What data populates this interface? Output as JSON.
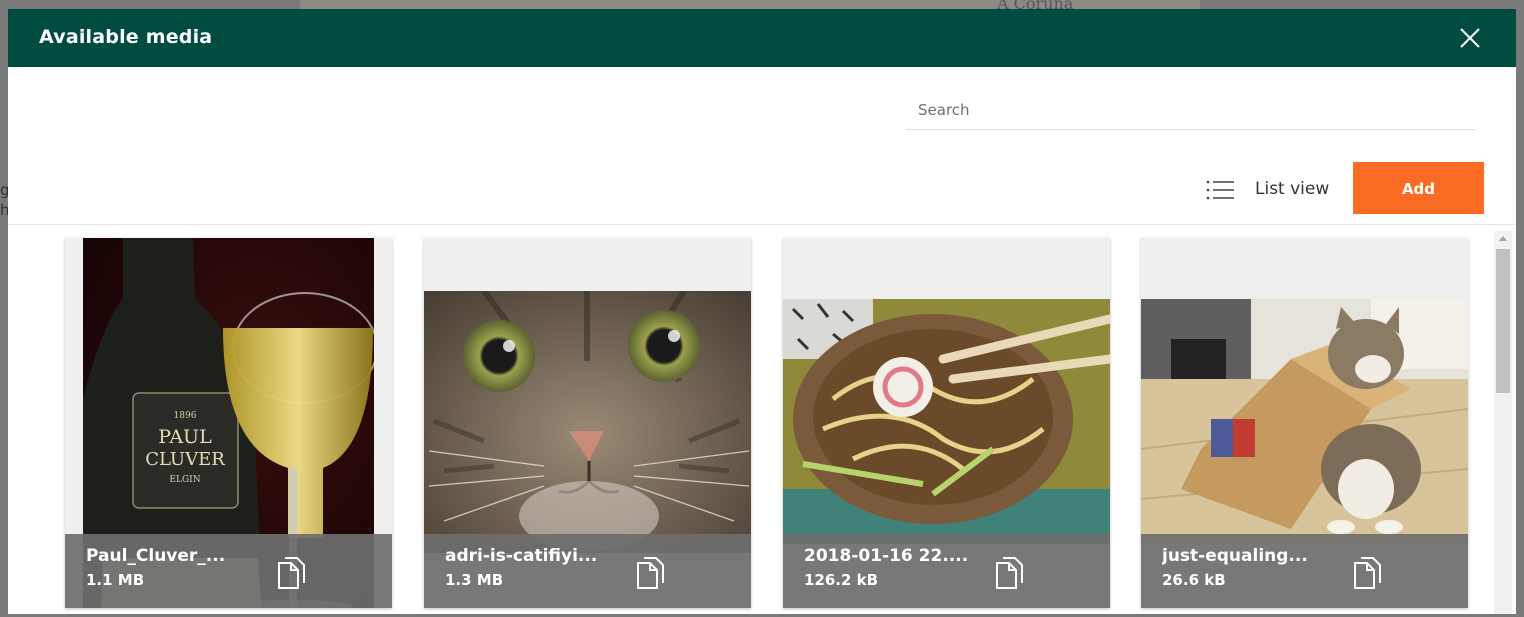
{
  "background": {
    "map_text": "A Coruña",
    "left_text": "ge\nh"
  },
  "modal": {
    "title": "Available media",
    "close_icon": "close-icon",
    "search": {
      "placeholder": "Search",
      "value": ""
    },
    "toolbar": {
      "list_view_label": "List view",
      "list_view_icon": "list-icon",
      "add_label": "Add"
    },
    "colors": {
      "header": "#004d40",
      "add_button": "#fa6b23",
      "caption_bg": "#6e6e6e"
    },
    "media": [
      {
        "name": "Paul_Cluver_...",
        "size": "1.1 MB",
        "thumb": "wine-bottle-and-glass",
        "icon": "copy-icon"
      },
      {
        "name": "adri-is-catifiyi...",
        "size": "1.3 MB",
        "thumb": "tabby-cat-face",
        "icon": "copy-icon"
      },
      {
        "name": "2018-01-16 22....",
        "size": "126.2 kB",
        "thumb": "noodle-bowl",
        "icon": "copy-icon"
      },
      {
        "name": "just-equaling...",
        "size": "26.6 kB",
        "thumb": "cat-in-box",
        "icon": "copy-icon"
      }
    ]
  }
}
